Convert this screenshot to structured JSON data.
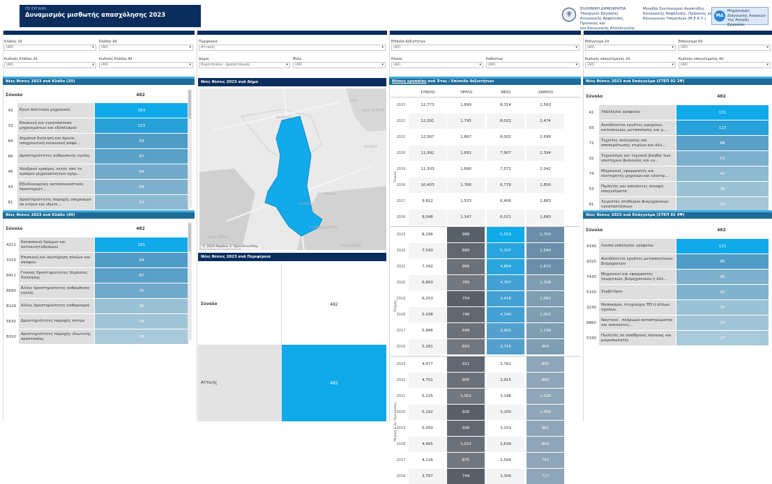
{
  "header": {
    "supertitle": "ΠΣ ΕΡΓΑΝΗ",
    "title": "Δυναμισμός μισθωτής απασχόλησης 2023",
    "gov_line1": "ΕΛΛΗΝΙΚΗ ΔΗΜΟΚΡΑΤΙΑ",
    "gov_line2": "Υπουργείο Εργασίας",
    "gov_line3": "Κοινωνικής Ασφάλισης, Πρόνοιας και",
    "gov_line4": "και Κοινωνικής Αλληλεγγύης",
    "unit_line1": "Μονάδα Συντονισμού Αναπτύξης",
    "unit_line2": "Κοινωνικής Ασφάλισης, Πρόνοιας και",
    "unit_line3": "Κοινωνικών Υπηρεσιών (Μ.Ε.Κ.Υ.)",
    "logo_line1": "Μηχανισμός",
    "logo_line2": "Διάγνωσης Αναγκών",
    "logo_line3": "της Αγοράς Εργασίας"
  },
  "filters": {
    "klados2": {
      "label": "Κλάδος 2d",
      "value": "(All)"
    },
    "klados4": {
      "label": "Κλάδος 4d",
      "value": "(All)"
    },
    "kodikos2": {
      "label": "Κωδικός Κλάδου 2d",
      "value": "(All)"
    },
    "kodikos4": {
      "label": "Κωδικός Κλάδου 4d",
      "value": "(All)"
    },
    "perifereia": {
      "label": "Περιφέρεια",
      "value": "Αττικής"
    },
    "dimos": {
      "label": "Δήμος",
      "value": "Κερατσινίου - Δραπετσώνας"
    },
    "fylo": {
      "label": "Φύλο",
      "value": "(All)"
    },
    "epipedo": {
      "label": "Επίπεδο Δεξιοτήτων",
      "value": "(All)"
    },
    "ilikia": {
      "label": "Ηλικία",
      "value": "(All)"
    },
    "kathestos": {
      "label": "Καθεστώς",
      "value": "(All)"
    },
    "epaggelma2": {
      "label": "Επάγγελμα 2d",
      "value": "(All)"
    },
    "epaggelma4": {
      "label": "Επάγγελμα 4d",
      "value": "(All)"
    },
    "kod_ep2": {
      "label": "Κωδικός επαγγέλματος 2d",
      "value": "(All)"
    },
    "kod_ep4": {
      "label": "Κωδικός επαγγέλματος 4d",
      "value": "(All)"
    }
  },
  "klados20": {
    "title": "Νέες θέσεις 2023 ανά Κλάδο (20)",
    "total_label": "Σύνολο",
    "total": "482",
    "rows": [
      {
        "code": "42",
        "name": "Εργα πολιτικού μηχανικού",
        "value": "163",
        "frac": 1.0,
        "color": "#10aaea"
      },
      {
        "code": "33",
        "name": "Επισκευή και εγκατάσταση μηχανημάτων και εξοπλισμού",
        "value": "123",
        "frac": 1.0,
        "color": "#27a1d8"
      },
      {
        "code": "84",
        "name": "Δημόσια διοίκηση και άμυνα, υποχρεωτική κοινωνική ασφά...",
        "value": "93",
        "frac": 1.0,
        "color": "#4f9cc6"
      },
      {
        "code": "86",
        "name": "Δραστηριότητες ανθρώπινης υγείας",
        "value": "87",
        "frac": 1.0,
        "color": "#5aa0c7"
      },
      {
        "code": "46",
        "name": "Χονδρικό εμπόριο, εκτός από το εμπόριο μηχανοκίνητων οχημ...",
        "value": "69",
        "frac": 1.0,
        "color": "#70a9c9"
      },
      {
        "code": "43",
        "name": "Εξειδικευμένες κατασκευαστικές δραστηριότ...",
        "value": "58",
        "frac": 1.0,
        "color": "#7cb0cc"
      },
      {
        "code": "81",
        "name": "Δραστηριότητες παροχής υπηρεσιών σε κτίρια και εξωτε...",
        "value": "43",
        "frac": 1.0,
        "color": "#8cb9d0"
      }
    ]
  },
  "klados40": {
    "title": "Νέες θέσεις 2023 ανά Κλάδο (40)",
    "total_label": "Σύνολο",
    "total": "482",
    "rows": [
      {
        "code": "4211",
        "name": "Κατασκευή δρόμων και αυτοκινητοδρόμων",
        "value": "161",
        "color": "#10aaea"
      },
      {
        "code": "3315",
        "name": "Επισκευή και συντήρηση πλοίων και σκαφών",
        "value": "94",
        "color": "#4f9cc6"
      },
      {
        "code": "8411",
        "name": "Γενικές δραστηριότητες δημόσιας διοίκησης",
        "value": "87",
        "color": "#5aa0c7"
      },
      {
        "code": "8690",
        "name": "Άλλες δραστηριότητες ανθρώπινης υγείας",
        "value": "70",
        "color": "#70a9c9"
      },
      {
        "code": "8129",
        "name": "Άλλες δραστηριότητες καθαρισμού",
        "value": "36",
        "color": "#9ac1d4"
      },
      {
        "code": "5630",
        "name": "Δραστηριότητες παροχής ποτών",
        "value": "34",
        "color": "#9fc4d6"
      },
      {
        "code": "8010",
        "name": "Δραστηριότητες παροχής ιδιωτικής προστασίας",
        "value": "28",
        "color": "#a8c9d9"
      }
    ]
  },
  "map": {
    "title": "Νέες θέσεις 2023 ανά Δήμο",
    "credit": "© 2024 Mapbox  © OpenStreetMap",
    "labels": [
      "NEAPOLI",
      "AGIA VARVAR",
      "ARIS",
      "KOUBIA",
      "PIREAS",
      "KAMINIA",
      "EVANGELISTRIA",
      "AGIA SOFIA",
      "PASALIMANI"
    ]
  },
  "perifereia": {
    "title": "Νέες θέσεις 2023 ανά Περιφέρεια",
    "total_label": "Σύνολο",
    "total": "482",
    "row_label": "Αττικής",
    "row_value": "482"
  },
  "skills": {
    "title_link": "Θέσεις εργασίας",
    "title_rest": " ανά Έτος / Επίπεδο δεξιοτήτων",
    "headers": [
      "ΣΥΝΟΛΟ",
      "ΥΨΗΛΟ",
      "ΜΕΣΟ",
      "ΧΑΜΗΛΟ"
    ],
    "groups": [
      {
        "name": "Σύνολο",
        "rows": [
          {
            "year": "2023",
            "v": [
              "12,773",
              "1,899",
              "8,314",
              "2,560"
            ]
          },
          {
            "year": "2022",
            "v": [
              "12,291",
              "1,795",
              "8,022",
              "2,474"
            ]
          },
          {
            "year": "2021",
            "v": [
              "12,567",
              "1,867",
              "8,002",
              "2,698"
            ]
          },
          {
            "year": "2020",
            "v": [
              "11,992",
              "1,691",
              "7,907",
              "2,394"
            ]
          },
          {
            "year": "2019",
            "v": [
              "11,303",
              "1,690",
              "7,571",
              "2,042"
            ]
          },
          {
            "year": "2018",
            "v": [
              "10,403",
              "1,768",
              "6,779",
              "1,856"
            ]
          },
          {
            "year": "2017",
            "v": [
              "9,812",
              "1,523",
              "6,406",
              "1,883"
            ]
          },
          {
            "year": "2016",
            "v": [
              "9,048",
              "1,347",
              "6,021",
              "1,680"
            ]
          }
        ]
      },
      {
        "name": "Πλήρης",
        "rows": [
          {
            "year": "2023",
            "v": [
              "8,296",
              "988",
              "5,553",
              "1,755"
            ]
          },
          {
            "year": "2022",
            "v": [
              "7,590",
              "889",
              "5,107",
              "1,594"
            ]
          },
          {
            "year": "2021",
            "v": [
              "7,342",
              "866",
              "4,804",
              "1,672"
            ]
          },
          {
            "year": "2020",
            "v": [
              "6,800",
              "765",
              "4,707",
              "1,328"
            ]
          },
          {
            "year": "2019",
            "v": [
              "6,253",
              "754",
              "4,418",
              "1,081"
            ]
          },
          {
            "year": "2018",
            "v": [
              "5,938",
              "746",
              "4,140",
              "1,052"
            ]
          },
          {
            "year": "2017",
            "v": [
              "5,686",
              "648",
              "3,902",
              "1,136"
            ]
          },
          {
            "year": "2016",
            "v": [
              "5,281",
              "603",
              "3,715",
              "963"
            ]
          }
        ]
      },
      {
        "name": "Μερική & Εκ Περιτροπής",
        "rows": [
          {
            "year": "2023",
            "v": [
              "4,477",
              "911",
              "2,761",
              "805"
            ]
          },
          {
            "year": "2022",
            "v": [
              "4,701",
              "906",
              "2,915",
              "880"
            ]
          },
          {
            "year": "2021",
            "v": [
              "5,225",
              "1,001",
              "3,198",
              "1,026"
            ]
          },
          {
            "year": "2020",
            "v": [
              "5,192",
              "926",
              "3,200",
              "1,066"
            ]
          },
          {
            "year": "2019",
            "v": [
              "5,050",
              "936",
              "3,153",
              "961"
            ]
          },
          {
            "year": "2018",
            "v": [
              "4,465",
              "1,022",
              "2,639",
              "804"
            ]
          },
          {
            "year": "2017",
            "v": [
              "4,126",
              "875",
              "2,504",
              "747"
            ]
          },
          {
            "year": "2016",
            "v": [
              "3,767",
              "744",
              "2,306",
              "717"
            ]
          }
        ]
      }
    ]
  },
  "epag20": {
    "title": "Νέες θέσεις 2023 ανά Επάγγελμα (ΣΤΕΠ 92 2Ψ)",
    "total_label": "Σύνολο",
    "total": "482",
    "rows": [
      {
        "code": "41",
        "name": "Υπάλληλοι γραφείου",
        "value": "131",
        "color": "#10aaea"
      },
      {
        "code": "93",
        "name": "Ανειδίκευτοι εργάτες ορυχείων, κατασκευών, μεταποίησης και μ...",
        "value": "123",
        "color": "#27a1d8"
      },
      {
        "code": "72",
        "name": "Τεχνίτες ανέγερσης και αποπεράτωσης κτιρίων και άλλ...",
        "value": "88",
        "color": "#5aa0c7"
      },
      {
        "code": "32",
        "name": "Τεχνολόγοι και τεχνικοί βοηθοί των επιστημών βιολογίας και υγ...",
        "value": "53",
        "color": "#7cb0cc"
      },
      {
        "code": "74",
        "name": "Μηχανικοί, εφαρμοστές και συντηρητές μηχανών και ηλεκτρ...",
        "value": "41",
        "color": "#8cb9d0"
      },
      {
        "code": "53",
        "name": "Πωλητές και ασκούντες συναφή επαγγέλματα",
        "value": "36",
        "color": "#9ac1d4"
      },
      {
        "code": "81",
        "name": "Χειριστές σταθερών βιομηχανικών εγκαταστάσεων",
        "value": "29",
        "color": "#a5c7d8"
      }
    ]
  },
  "epag40": {
    "title": "Νέες θέσεις 2023 ανά Επάγγελμα (ΣΤΕΠ 92 4Ψ)",
    "total_label": "Σύνολο",
    "total": "482",
    "rows": [
      {
        "code": "4190",
        "name": "Λοιποί υπάλληλοι γραφείου",
        "value": "121",
        "color": "#10aaea"
      },
      {
        "code": "9320",
        "name": "Ανειδίκευτοι εργάτες μεταποιητικών βιομηχανιών",
        "value": "95",
        "color": "#4f9cc6"
      },
      {
        "code": "7430",
        "name": "Μηχανικοί και εφαρμοστές γεωργικών, βιομηχανικών ή άλλ...",
        "value": "45",
        "color": "#7cb0cc"
      },
      {
        "code": "5150",
        "name": "Σερβιτόροι",
        "value": "42",
        "color": "#80b2cd"
      },
      {
        "code": "3230",
        "name": "Νοσοκόμοι, πτυχιούχοι ΤΕΙ ή άλλων σχολών",
        "value": "35",
        "color": "#9ac1d4"
      },
      {
        "code": "8860",
        "name": "Ναυτικοί - πλήρωμα καταστρώματος και ασκούντες...",
        "value": "33",
        "color": "#9fc4d6"
      },
      {
        "code": "5330",
        "name": "Πωλητές σε υπαίθριους πάγκους και μικροπωλητές",
        "value": "27",
        "color": "#a8c9d9"
      }
    ]
  },
  "colors": {
    "navy": "#0a2d5c",
    "teal": "#1e6c96",
    "bright": "#10aaea",
    "dark_cell": "#5c6470"
  }
}
